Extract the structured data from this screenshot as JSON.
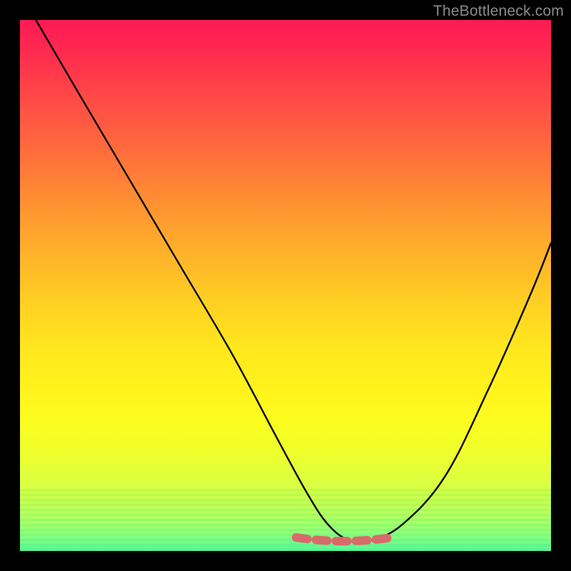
{
  "watermark": {
    "text": "TheBottleneck.com"
  },
  "colors": {
    "frame": "#000000",
    "curve_stroke": "#000000",
    "bottom_marker": "#d96a6a",
    "gradient_top": "#ff1a55",
    "gradient_bottom": "#56f79a"
  },
  "chart_data": {
    "type": "line",
    "title": "",
    "xlabel": "",
    "ylabel": "",
    "xlim": [
      0,
      100
    ],
    "ylim": [
      0,
      100
    ],
    "series": [
      {
        "name": "bottleneck-curve",
        "x": [
          3,
          10,
          20,
          30,
          40,
          48,
          54,
          58,
          62,
          66,
          72,
          80,
          88,
          96,
          100
        ],
        "values": [
          100,
          88,
          71,
          54,
          37,
          22,
          11,
          5,
          2,
          2,
          5,
          14,
          30,
          48,
          58
        ]
      }
    ],
    "bottom_marker": {
      "name": "optimal-range",
      "y": 2,
      "x_start": 52,
      "x_end": 70
    },
    "grid": false,
    "legend": false
  }
}
